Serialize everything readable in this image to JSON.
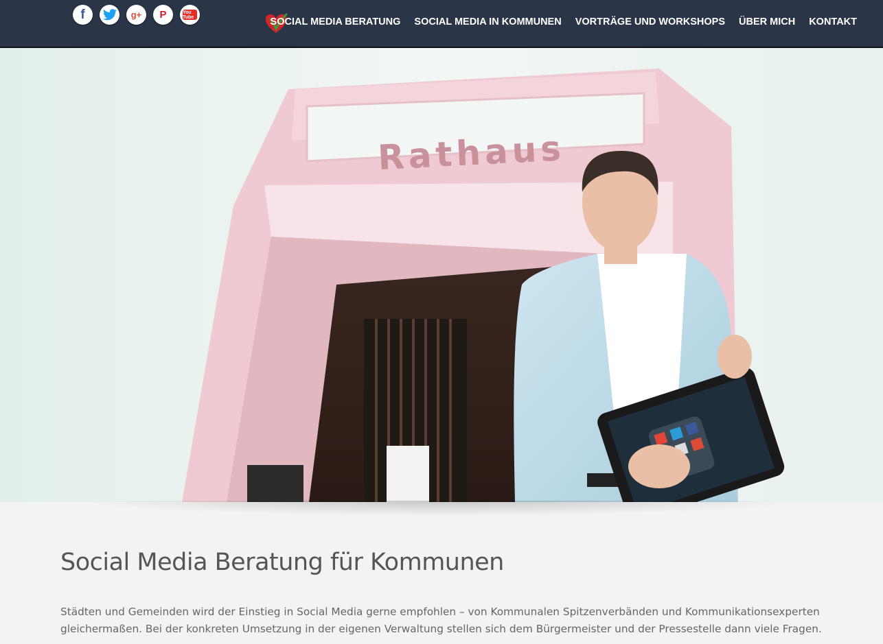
{
  "social": {
    "icons": [
      "facebook-icon",
      "twitter-icon",
      "google-plus-icon",
      "pinterest-icon",
      "youtube-icon"
    ],
    "fb": "f",
    "tw": "t",
    "gp": "g+",
    "pi": "P",
    "yt": "You Tube"
  },
  "nav": {
    "items": [
      {
        "label": "SOCIAL MEDIA BERATUNG"
      },
      {
        "label": "SOCIAL MEDIA IN KOMMUNEN"
      },
      {
        "label": "VORTRÄGE UND WORKSHOPS"
      },
      {
        "label": "ÜBER MICH"
      },
      {
        "label": "KONTAKT"
      }
    ]
  },
  "hero": {
    "sign_text": "Rathaus"
  },
  "main": {
    "title": "Social Media Beratung für Kommunen",
    "paragraph": "Städten und Gemeinden wird der Einstieg in Social Media gerne empfohlen – von Kommunalen Spitzenverbänden und Kommunikationsexperten gleichermaßen. Bei der konkreten Umsetzung in der eigenen Verwaltung stellen sich dem Bürgermeister und der Pressestelle dann viele Fragen."
  },
  "colors": {
    "header_bg": "#2a3648",
    "heart_red": "#d6252a",
    "heart_green": "#3a9a3a"
  }
}
